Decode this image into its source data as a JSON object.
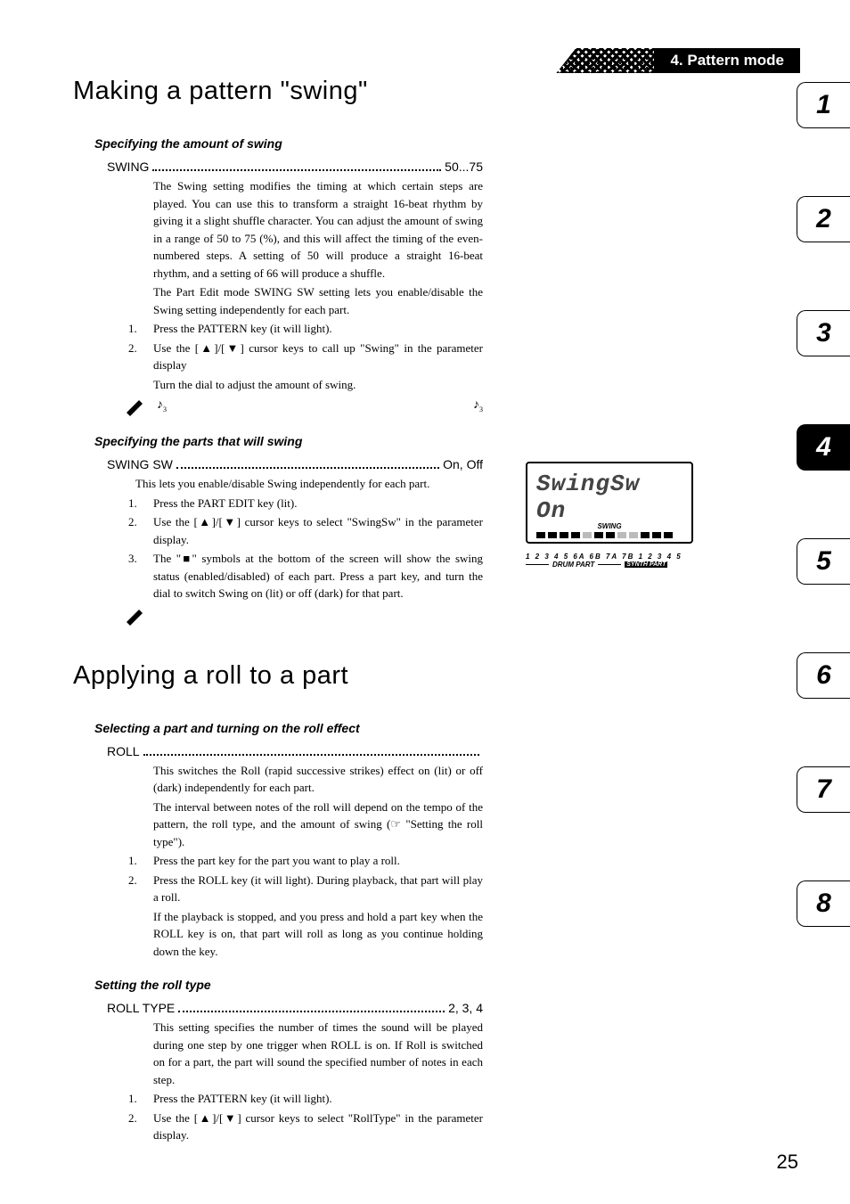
{
  "header": {
    "mode_title": "4. Pattern mode"
  },
  "tabs": [
    "1",
    "2",
    "3",
    "4",
    "5",
    "6",
    "7",
    "8"
  ],
  "active_tab_index": 3,
  "page_number": "25",
  "sec1": {
    "title": "Making a pattern \"swing\"",
    "sub1": "Specifying the amount of swing",
    "param1_label": "SWING",
    "param1_value": "50...75",
    "p1a": "The Swing setting modifies the timing at which certain steps are played. You can use this to transform a straight 16-beat rhythm by giving it a slight shuffle character. You can adjust the amount of swing in a range of 50 to 75 (%), and this will affect the timing of the even-numbered steps. A setting of 50 will produce a straight 16-beat rhythm, and a setting of 66 will produce a shuffle.",
    "p1b": "The Part Edit mode SWING SW setting lets you enable/disable the Swing setting independently for each part.",
    "steps1": [
      "Press the PATTERN key (it will light).",
      "Use the [▲]/[▼] cursor keys to call up \"Swing\" in the parameter display",
      "Turn the dial to adjust the amount of swing."
    ],
    "sub2": "Specifying the parts that will swing",
    "param2_label": "SWING SW",
    "param2_value": "On, Off",
    "p2a": "This lets you enable/disable Swing independently for each part.",
    "steps2": [
      "Press the PART EDIT key (lit).",
      "Use the [▲]/[▼] cursor keys to select \"SwingSw\" in the parameter display.",
      "The \"■\" symbols at the bottom of the screen will show the swing status (enabled/disabled) of each part. Press a part key, and turn the dial to switch Swing on (lit) or off (dark) for that part."
    ]
  },
  "sec2": {
    "title": "Applying a roll to a part",
    "sub1": "Selecting a part and turning on the roll effect",
    "param1_label": "ROLL",
    "param1_value": "",
    "p1a": "This switches the Roll (rapid successive strikes) effect on (lit) or off (dark) independently for each part.",
    "p1b": "The interval between notes of the roll will depend on the tempo of the pattern, the roll type, and the amount of swing (☞ \"Setting the roll type\").",
    "steps1": [
      "Press the part key for the part you want to play a roll.",
      "Press the ROLL key (it will light). During playback, that part will play a roll."
    ],
    "p1c": "If the playback is stopped, and you press and hold a part key when the ROLL key is on, that part will roll as long as you continue holding down the key.",
    "sub2": "Setting the roll type",
    "param2_label": "ROLL TYPE",
    "param2_value": "2, 3, 4",
    "p2a": "This setting specifies the number of times the sound will be played during one step by one trigger when ROLL is on. If Roll is switched on for a part, the part will sound the specified number of notes in each step.",
    "steps2": [
      "Press the PATTERN key (it will light).",
      "Use the [▲]/[▼] cursor keys to select \"RollType\" in the parameter display."
    ]
  },
  "lcd": {
    "line1": "SwingSw",
    "line2": "On",
    "swing_label": "SWING",
    "nums": "1 2 3 4 5 6A 6B 7A 7B 1 2 3 4 5",
    "drum": "DRUM PART",
    "synth": "SYNTH PART"
  }
}
